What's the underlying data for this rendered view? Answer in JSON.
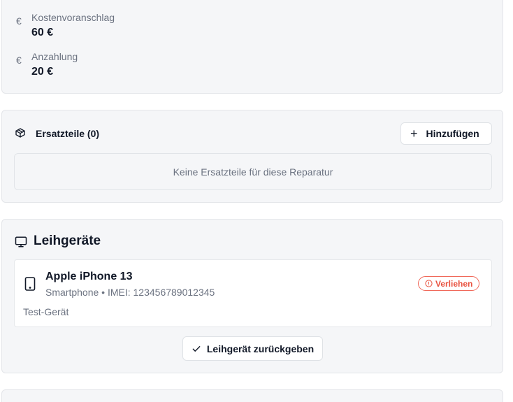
{
  "costs": {
    "estimate": {
      "label": "Kostenvoranschlag",
      "value": "60 €",
      "icon": "euro-icon"
    },
    "deposit": {
      "label": "Anzahlung",
      "value": "20 €",
      "icon": "euro-icon"
    }
  },
  "parts": {
    "icon": "package-icon",
    "title": "Ersatzteile (0)",
    "add_button": "Hinzufügen",
    "empty_text": "Keine Ersatzteile für diese Reparatur"
  },
  "loan": {
    "icon": "monitor-icon",
    "title": "Leihgeräte",
    "device": {
      "icon": "smartphone-icon",
      "name": "Apple iPhone 13",
      "meta": "Smartphone • IMEI: 123456789012345",
      "note": "Test-Gerät",
      "status": "Verliehen",
      "status_color": "#e8523f"
    },
    "return_button": "Leihgerät zurückgeben"
  }
}
